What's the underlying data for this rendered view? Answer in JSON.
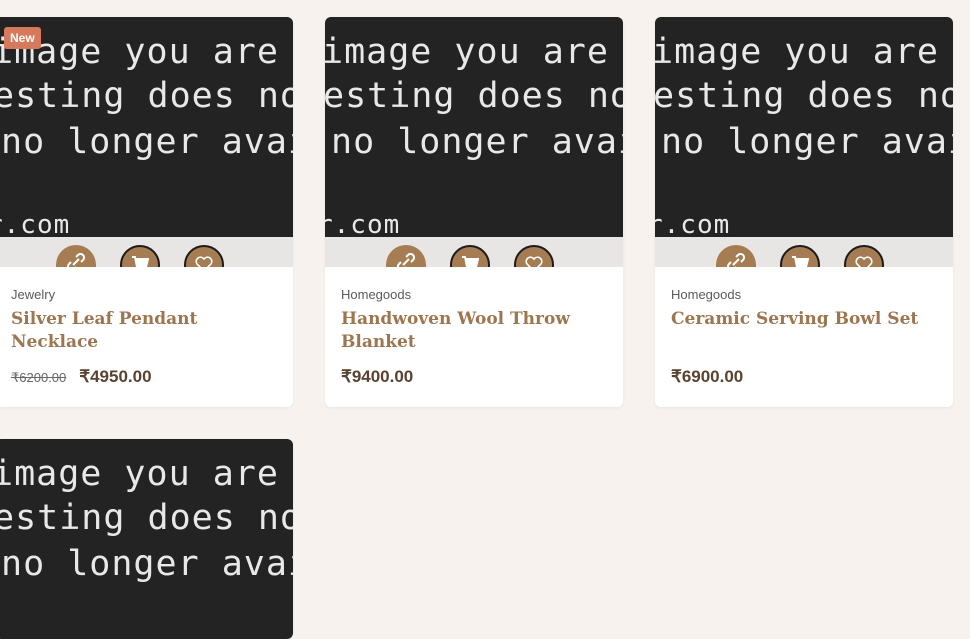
{
  "placeholder_lines": [
    "image you are",
    "esting does not r",
    "no longer availa",
    "r.com"
  ],
  "badge": "New",
  "action_icons": [
    "link-icon",
    "cart-icon",
    "heart-icon"
  ],
  "products": [
    {
      "category": "Jewelry",
      "name": "Silver Leaf Pendant Necklace",
      "old_price": "₹6200.00",
      "price": "₹4950.00"
    },
    {
      "category": "Homegoods",
      "name": "Handwoven Wool Throw Blanket",
      "price": "₹9400.00"
    },
    {
      "category": "Homegoods",
      "name": "Ceramic Serving Bowl Set",
      "price": "₹6900.00"
    }
  ],
  "colors": {
    "accent": "#a67c52",
    "badge": "#d77a5b",
    "title": "#9d7650",
    "background": "#f7f2ee"
  }
}
